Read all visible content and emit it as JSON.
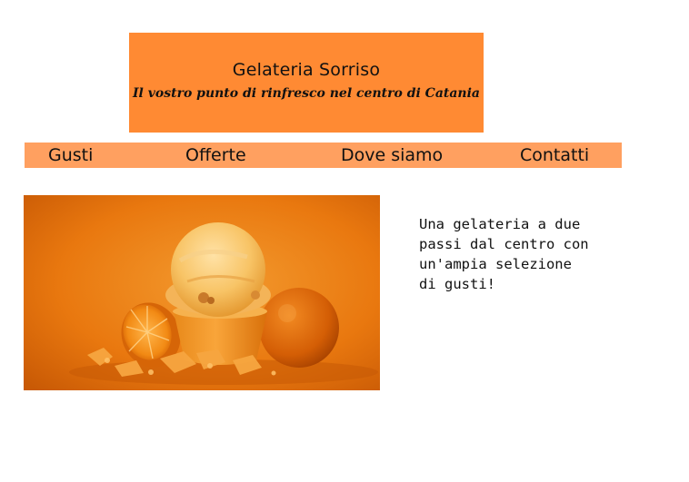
{
  "header": {
    "title": "Gelateria Sorriso",
    "subtitle": "Il vostro punto di rinfresco nel centro di Catania"
  },
  "nav": {
    "items": [
      "Gusti",
      "Offerte",
      "Dove siamo",
      "Contatti"
    ]
  },
  "main": {
    "image_subject": "ice-cream-with-oranges",
    "description_lines": [
      "Una gelateria a due",
      "passi dal centro con",
      "un'ampia selezione",
      "di gusti!"
    ]
  },
  "colors": {
    "banner": "#ff8a33",
    "nav": "#ffa060",
    "text": "#111111"
  }
}
